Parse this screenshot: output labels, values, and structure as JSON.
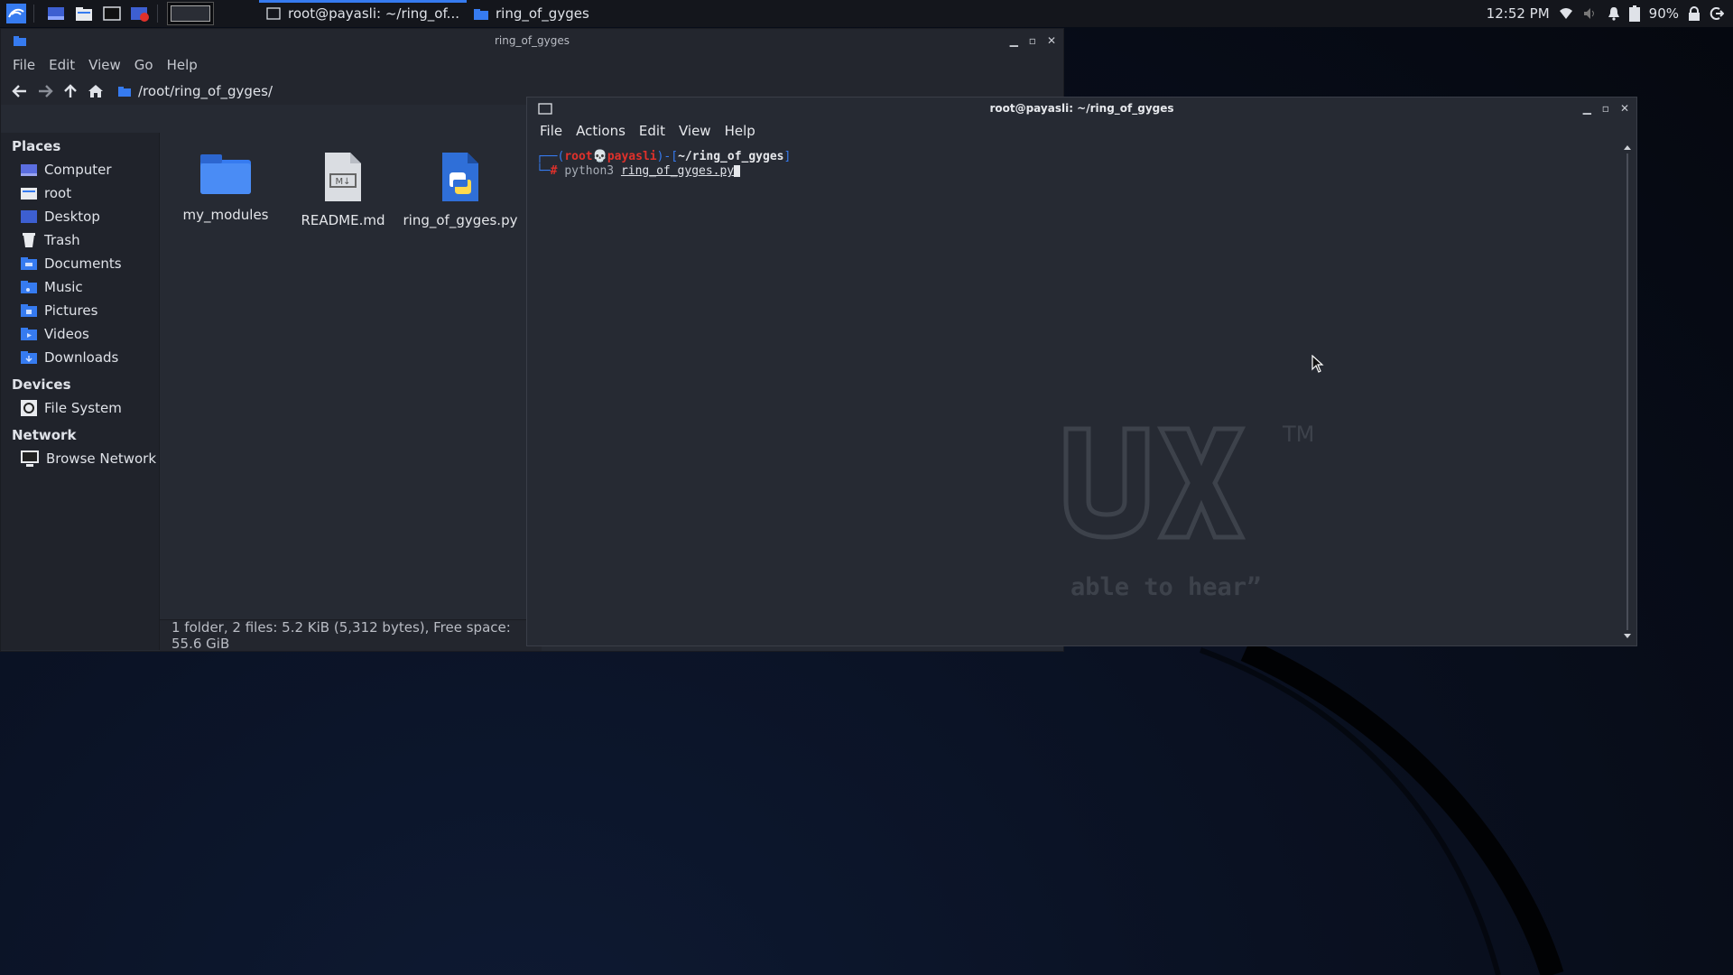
{
  "taskbar": {
    "tasks": [
      {
        "label": "root@payasli: ~/ring_of..."
      },
      {
        "label": "ring_of_gyges"
      }
    ],
    "clock": "12:52 PM",
    "battery": "90%"
  },
  "file_manager": {
    "title": "ring_of_gyges",
    "menu": [
      "File",
      "Edit",
      "View",
      "Go",
      "Help"
    ],
    "path": "/root/ring_of_gyges/",
    "sidebar": {
      "places_header": "Places",
      "places": [
        "Computer",
        "root",
        "Desktop",
        "Trash",
        "Documents",
        "Music",
        "Pictures",
        "Videos",
        "Downloads"
      ],
      "devices_header": "Devices",
      "devices": [
        "File System"
      ],
      "network_header": "Network",
      "network": [
        "Browse Network"
      ]
    },
    "files": [
      {
        "name": "my_modules",
        "type": "folder"
      },
      {
        "name": "README.md",
        "type": "markdown"
      },
      {
        "name": "ring_of_gyges.py",
        "type": "python"
      }
    ],
    "status": "1 folder, 2 files: 5.2 KiB (5,312 bytes), Free space: 55.6 GiB"
  },
  "terminal": {
    "title": "root@payasli: ~/ring_of_gyges",
    "menu": [
      "File",
      "Actions",
      "Edit",
      "View",
      "Help"
    ],
    "prompt": {
      "user": "root",
      "host": "payasli",
      "cwd": "~/ring_of_gyges",
      "command": "python3",
      "argument": "ring_of_gyges.py"
    }
  },
  "desktop": {
    "watermark_text": "able to hear”",
    "watermark_tm": "TM"
  },
  "colors": {
    "accent": "#367bf0",
    "prompt_red": "#e0312b"
  }
}
